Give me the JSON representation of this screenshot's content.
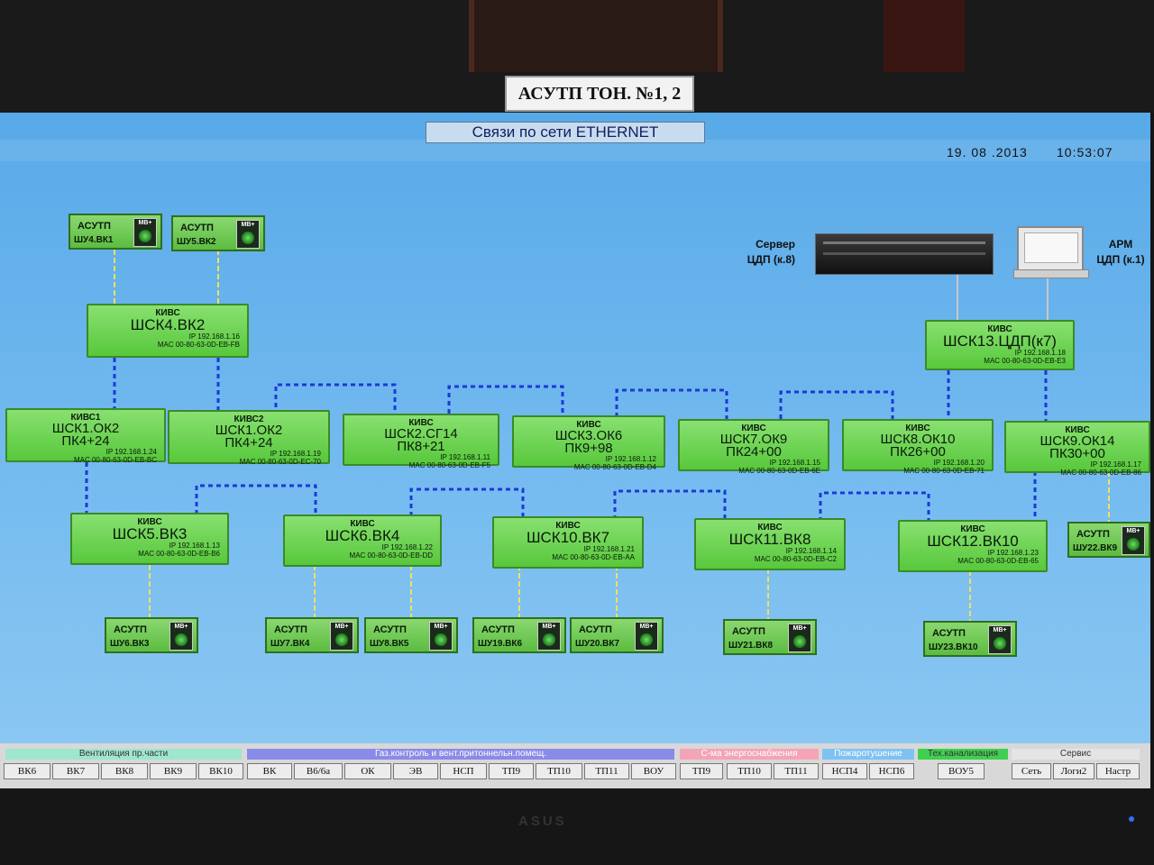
{
  "plate": "АСУТП ТОН. №1, 2",
  "screen": {
    "title": "Связи по сети ETHERNET",
    "date": "19. 08 .2013",
    "time": "10:53:07"
  },
  "devices": {
    "server_label_1": "Сервер",
    "server_label_2": "ЦДП (к.8)",
    "arm_label_1": "АРМ",
    "arm_label_2": "ЦДП (к.1)"
  },
  "mb_label": "МВ+",
  "shu_title": "АСУТП",
  "boxes": [
    {
      "kivs": "КИВС",
      "name": "ШСК4.ВК2",
      "name2": "",
      "ip": "IP 192.168.1.16",
      "mac": "MAC 00-80-63-0D-EB-FB"
    },
    {
      "kivs": "КИВС",
      "name": "ШСК13.ЦДП(к7)",
      "name2": "",
      "ip": "IP 192.168.1.18",
      "mac": "MAC 00-80-63-0D-EB-E3"
    },
    {
      "kivs": "КИВС1",
      "name": "ШСК1.ОК2",
      "name2": "ПК4+24",
      "ip": "IP 192.168.1.24",
      "mac": "MAC 00-80-63-0D-EB-BC"
    },
    {
      "kivs": "КИВС2",
      "name": "ШСК1.ОК2",
      "name2": "ПК4+24",
      "ip": "IP 192.168.1.19",
      "mac": "MAC 00-80-63-0D-EC-70"
    },
    {
      "kivs": "КИВС",
      "name": "ШСК2.СГ14",
      "name2": "ПК8+21",
      "ip": "IP 192.168.1.11",
      "mac": "MAC 00-80-63-0D-EB-F5"
    },
    {
      "kivs": "КИВС",
      "name": "ШСК3.ОК6",
      "name2": "ПК9+98",
      "ip": "IP 192.168.1.12",
      "mac": "MAC 00-80-63-0D-EB-D4"
    },
    {
      "kivs": "КИВС",
      "name": "ШСК7.ОК9",
      "name2": "ПК24+00",
      "ip": "IP 192.168.1.15",
      "mac": "MAC 00-80-63-0D-EB-6E"
    },
    {
      "kivs": "КИВС",
      "name": "ШСК8.ОК10",
      "name2": "ПК26+00",
      "ip": "IP 192.168.1.20",
      "mac": "MAC 00-80-63-0D-EB-71"
    },
    {
      "kivs": "КИВС",
      "name": "ШСК9.ОК14",
      "name2": "ПК30+00",
      "ip": "IP 192.168.1.17",
      "mac": "MAC 00-80-63-0D-EB-86"
    },
    {
      "kivs": "КИВС",
      "name": "ШСК5.ВК3",
      "name2": "",
      "ip": "IP 192.168.1.13",
      "mac": "MAC 00-80-63-0D-EB-B6"
    },
    {
      "kivs": "КИВС",
      "name": "ШСК6.ВК4",
      "name2": "",
      "ip": "IP 192.168.1.22",
      "mac": "MAC 00-80-63-0D-EB-DD"
    },
    {
      "kivs": "КИВС",
      "name": "ШСК10.ВК7",
      "name2": "",
      "ip": "IP 192.168.1.21",
      "mac": "MAC 00-80-63-0D-EB-AA"
    },
    {
      "kivs": "КИВС",
      "name": "ШСК11.ВК8",
      "name2": "",
      "ip": "IP 192.168.1.14",
      "mac": "MAC 00-80-63-0D-EB-C2"
    },
    {
      "kivs": "КИВС",
      "name": "ШСК12.ВК10",
      "name2": "",
      "ip": "IP 192.168.1.23",
      "mac": "MAC 00-80-63-0D-EB-65"
    }
  ],
  "shu": [
    "ШУ4.ВК1",
    "ШУ5.ВК2",
    "ШУ6.ВК3",
    "ШУ7.ВК4",
    "ШУ8.ВК5",
    "ШУ19.ВК6",
    "ШУ20.ВК7",
    "ШУ21.ВК8",
    "ШУ23.ВК10",
    "ШУ22.ВК9"
  ],
  "bottom": {
    "groups": [
      {
        "title": "Вентиляция пр.части",
        "color": "#7de0c0"
      },
      {
        "title": "Газ.контроль и вент.притоннельн.помещ.",
        "color": "#5a5ad8"
      },
      {
        "title": "С-ма энергоснабжения",
        "color": "#f08aa0"
      },
      {
        "title": "Пожаротушение",
        "color": "#5ab0f0"
      },
      {
        "title": "Тех.канализация",
        "color": "#30d040"
      },
      {
        "title": "Сервис",
        "color": "#dcdcdc"
      }
    ],
    "buttons": [
      "ВК6",
      "ВК7",
      "ВК8",
      "ВК9",
      "ВК10",
      "ВК",
      "В6/6а",
      "ОК",
      "ЭВ",
      "НСП",
      "ТП9",
      "ТП10",
      "ТП11",
      "ВОУ",
      "ТП9",
      "ТП10",
      "ТП11",
      "НСП4",
      "НСП6",
      "ВОУ5",
      "Сеть",
      "Логи2",
      "Настр"
    ]
  },
  "monitor_brand": "ASUS"
}
